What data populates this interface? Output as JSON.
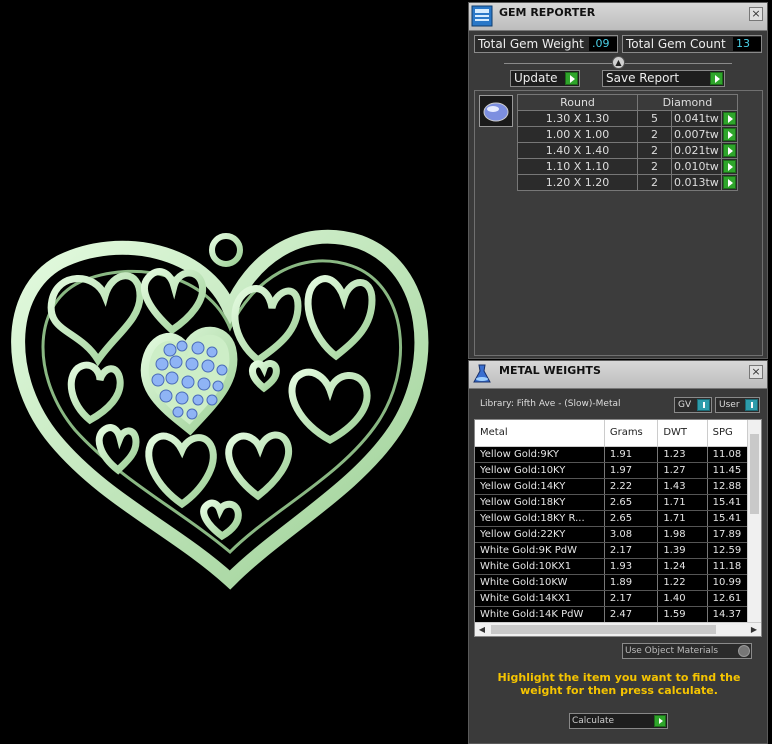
{
  "gem_reporter": {
    "title": "GEM REPORTER",
    "close_glyph": "×",
    "total_gem_weight_label": "Total Gem Weight",
    "total_gem_weight_value": ".09",
    "total_gem_count_label": "Total Gem Count",
    "total_gem_count_value": "13",
    "update_label": "Update",
    "save_report_label": "Save Report",
    "shape_header": "Round",
    "material_header": "Diamond",
    "rows": [
      {
        "size": "1.30 X 1.30",
        "count": "5",
        "weight": "0.041tw"
      },
      {
        "size": "1.00 X 1.00",
        "count": "2",
        "weight": "0.007tw"
      },
      {
        "size": "1.40 X 1.40",
        "count": "2",
        "weight": "0.021tw"
      },
      {
        "size": "1.10 X 1.10",
        "count": "2",
        "weight": "0.010tw"
      },
      {
        "size": "1.20 X 1.20",
        "count": "2",
        "weight": "0.013tw"
      }
    ]
  },
  "metal_weights": {
    "title": "METAL WEIGHTS",
    "close_glyph": "×",
    "library_label": "Library: Fifth Ave - (Slow)-Metal",
    "gv_label": "GV",
    "user_label": "User",
    "columns": [
      "Metal",
      "Grams",
      "DWT",
      "SPG"
    ],
    "rows": [
      {
        "metal": "Yellow Gold:9KY",
        "grams": "1.91",
        "dwt": "1.23",
        "spg": "11.08"
      },
      {
        "metal": "Yellow Gold:10KY",
        "grams": "1.97",
        "dwt": "1.27",
        "spg": "11.45"
      },
      {
        "metal": "Yellow Gold:14KY",
        "grams": "2.22",
        "dwt": "1.43",
        "spg": "12.88"
      },
      {
        "metal": "Yellow Gold:18KY",
        "grams": "2.65",
        "dwt": "1.71",
        "spg": "15.41"
      },
      {
        "metal": "Yellow Gold:18KY R...",
        "grams": "2.65",
        "dwt": "1.71",
        "spg": "15.41"
      },
      {
        "metal": "Yellow Gold:22KY",
        "grams": "3.08",
        "dwt": "1.98",
        "spg": "17.89"
      },
      {
        "metal": "White Gold:9K PdW",
        "grams": "2.17",
        "dwt": "1.39",
        "spg": "12.59"
      },
      {
        "metal": "White Gold:10KX1",
        "grams": "1.93",
        "dwt": "1.24",
        "spg": "11.18"
      },
      {
        "metal": "White Gold:10KW",
        "grams": "1.89",
        "dwt": "1.22",
        "spg": "10.99"
      },
      {
        "metal": "White Gold:14KX1",
        "grams": "2.17",
        "dwt": "1.40",
        "spg": "12.61"
      },
      {
        "metal": "White Gold:14K PdW",
        "grams": "2.47",
        "dwt": "1.59",
        "spg": "14.37"
      }
    ],
    "use_object_materials_label": "Use Object Materials",
    "hint_text": "Highlight the item you want to find the weight for then press calculate.",
    "calculate_label": "Calculate"
  },
  "colors": {
    "metal_green": "#c8f0c0",
    "gem_blue": "#8fb4f5",
    "accent_green": "#2fa52b",
    "value_cyan": "#4bd1e8",
    "hint_yellow": "#f5c400"
  },
  "icons": [
    "gem-reporter-icon",
    "metal-weights-icon",
    "close-icon",
    "play-arrow-icon",
    "round-gem-thumbnail-icon"
  ]
}
